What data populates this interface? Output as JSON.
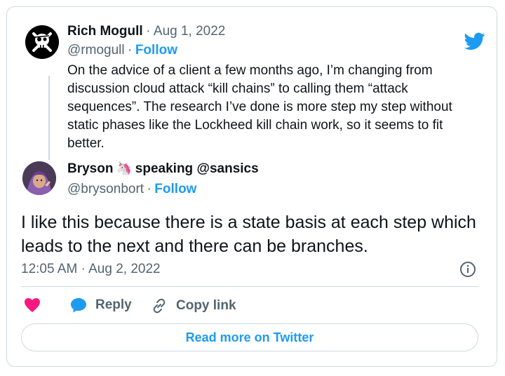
{
  "quoted_tweet": {
    "author_name": "Rich Mogull",
    "separator": "·",
    "date": "Aug 1, 2022",
    "handle": "@rmogull",
    "follow_label": "Follow",
    "text": "On the advice of a client a few months ago, I’m changing from discussion cloud attack “kill chains” to calling them “attack sequences”. The research I’ve done is more step my step without static phases like the Lockheed kill chain work, so it seems to fit better."
  },
  "main_tweet": {
    "author_name_part1": "Bryson",
    "author_emoji": "🦄",
    "author_name_part2": "speaking @sansics",
    "handle": "@brysonbort",
    "separator": "·",
    "follow_label": "Follow",
    "text": "I like this because there is a state basis at each step which leads to the next and there can be branches.",
    "timestamp": "12:05 AM · Aug 2, 2022"
  },
  "actions": {
    "like_label": "",
    "reply_label": "Reply",
    "copy_link_label": "Copy link"
  },
  "read_more_label": "Read more on Twitter",
  "colors": {
    "accent": "#1d9bf0",
    "like": "#f91880",
    "text": "#0f1419",
    "muted": "#536471",
    "border": "#cfd9de"
  },
  "icons": [
    "twitter-logo-icon",
    "info-icon",
    "heart-icon",
    "reply-bubble-icon",
    "link-icon"
  ]
}
